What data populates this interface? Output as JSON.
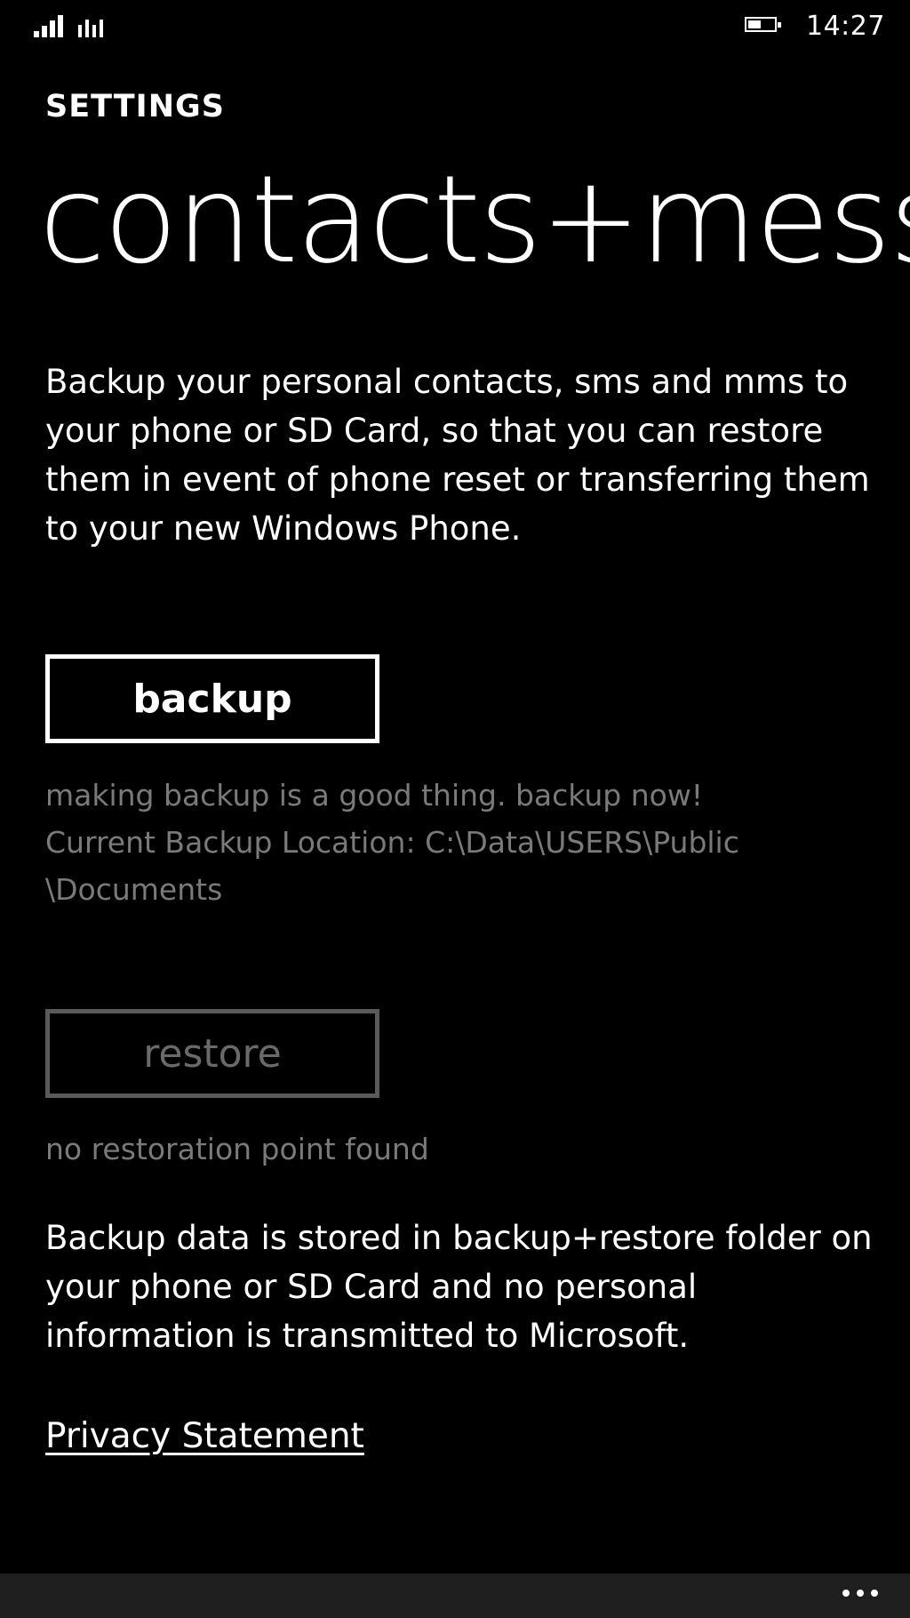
{
  "status_bar": {
    "time": "14:27",
    "battery_level": 0.5
  },
  "header": {
    "eyebrow": "SETTINGS",
    "title": "contacts+mess"
  },
  "intro_text": "Backup your personal contacts, sms and mms to your phone or SD Card, so that you can restore them in event of phone reset or transferring them to your new Windows Phone.",
  "backup": {
    "button_label": "backup",
    "hint_line1": "making backup is a good thing. backup now!",
    "hint_line2": "Current Backup Location: C:\\Data\\USERS\\Public",
    "hint_line3": "\\Documents"
  },
  "restore": {
    "button_label": "restore",
    "hint": "no restoration point found",
    "enabled": false
  },
  "footer_note": "Backup data is stored in backup+restore folder on your phone or SD Card and no personal information is transmitted to Microsoft.",
  "privacy_link": "Privacy Statement",
  "app_bar": {
    "more_icon": "ellipsis-icon"
  },
  "colors": {
    "background": "#000000",
    "foreground": "#ffffff",
    "subtle_text": "#7a7a7a",
    "disabled": "#5a5a5a",
    "app_bar": "#1f1f1f"
  }
}
